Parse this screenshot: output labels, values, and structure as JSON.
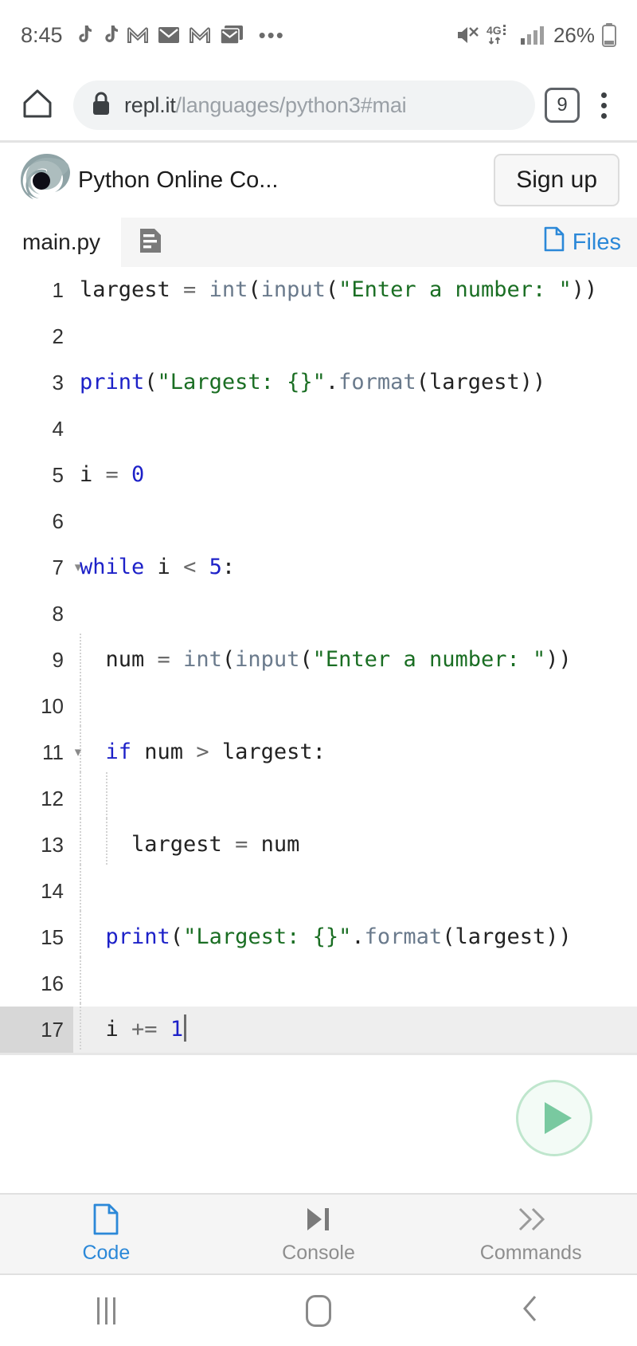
{
  "status_bar": {
    "time": "8:45",
    "notification_icons": [
      "tiktok-icon",
      "tiktok-icon",
      "gmail-icon",
      "mail-filled-icon",
      "gmail-icon",
      "mail-stack-icon"
    ],
    "overflow": "•••",
    "mute_icon": "volume-muted-icon",
    "network_label": "4G",
    "signal_icon": "signal-bars-icon",
    "battery_percent": "26%"
  },
  "browser": {
    "home_icon": "home-icon",
    "lock_icon": "lock-icon",
    "url_host": "repl.it",
    "url_path": "/languages/python3#mai",
    "url_full": "repl.it/languages/python3#mai",
    "tab_count": "9",
    "menu_icon": "kebab-menu-icon"
  },
  "app_header": {
    "logo_icon": "replit-swirl-logo",
    "title": "Python Online Co...",
    "signup_label": "Sign up"
  },
  "editor_tabs": {
    "filename": "main.py",
    "panel_icon": "file-lines-icon",
    "files_label": "Files",
    "files_icon": "file-icon"
  },
  "code": {
    "lines": [
      {
        "n": "1",
        "fold": "",
        "indent": 0,
        "tokens": [
          {
            "t": "largest ",
            "c": "plain"
          },
          {
            "t": "= ",
            "c": "op"
          },
          {
            "t": "int",
            "c": "fn"
          },
          {
            "t": "(",
            "c": "plain"
          },
          {
            "t": "input",
            "c": "fn"
          },
          {
            "t": "(",
            "c": "plain"
          },
          {
            "t": "\"Enter a number: \"",
            "c": "str"
          },
          {
            "t": "))",
            "c": "plain"
          }
        ]
      },
      {
        "n": "2",
        "fold": "",
        "indent": 0,
        "tokens": []
      },
      {
        "n": "3",
        "fold": "",
        "indent": 0,
        "tokens": [
          {
            "t": "print",
            "c": "kw"
          },
          {
            "t": "(",
            "c": "plain"
          },
          {
            "t": "\"Largest: {}\"",
            "c": "str"
          },
          {
            "t": ".",
            "c": "plain"
          },
          {
            "t": "format",
            "c": "fn"
          },
          {
            "t": "(largest))",
            "c": "plain"
          }
        ]
      },
      {
        "n": "4",
        "fold": "",
        "indent": 0,
        "tokens": []
      },
      {
        "n": "5",
        "fold": "",
        "indent": 0,
        "tokens": [
          {
            "t": "i ",
            "c": "plain"
          },
          {
            "t": "= ",
            "c": "op"
          },
          {
            "t": "0",
            "c": "num"
          }
        ]
      },
      {
        "n": "6",
        "fold": "",
        "indent": 0,
        "tokens": []
      },
      {
        "n": "7",
        "fold": "▾",
        "indent": 0,
        "tokens": [
          {
            "t": "while",
            "c": "kw"
          },
          {
            "t": " i ",
            "c": "plain"
          },
          {
            "t": "< ",
            "c": "op"
          },
          {
            "t": "5",
            "c": "num"
          },
          {
            "t": ":",
            "c": "plain"
          }
        ]
      },
      {
        "n": "8",
        "fold": "",
        "indent": 0,
        "tokens": []
      },
      {
        "n": "9",
        "fold": "",
        "indent": 1,
        "tokens": [
          {
            "t": "  num ",
            "c": "plain"
          },
          {
            "t": "= ",
            "c": "op"
          },
          {
            "t": "int",
            "c": "fn"
          },
          {
            "t": "(",
            "c": "plain"
          },
          {
            "t": "input",
            "c": "fn"
          },
          {
            "t": "(",
            "c": "plain"
          },
          {
            "t": "\"Enter a number: \"",
            "c": "str"
          },
          {
            "t": "))",
            "c": "plain"
          }
        ]
      },
      {
        "n": "10",
        "fold": "",
        "indent": 1,
        "tokens": []
      },
      {
        "n": "11",
        "fold": "▾",
        "indent": 1,
        "tokens": [
          {
            "t": "  ",
            "c": "plain"
          },
          {
            "t": "if",
            "c": "kw"
          },
          {
            "t": " num ",
            "c": "plain"
          },
          {
            "t": "> ",
            "c": "op"
          },
          {
            "t": "largest:",
            "c": "plain"
          }
        ]
      },
      {
        "n": "12",
        "fold": "",
        "indent": 2,
        "tokens": []
      },
      {
        "n": "13",
        "fold": "",
        "indent": 2,
        "tokens": [
          {
            "t": "    largest ",
            "c": "plain"
          },
          {
            "t": "= ",
            "c": "op"
          },
          {
            "t": "num",
            "c": "plain"
          }
        ]
      },
      {
        "n": "14",
        "fold": "",
        "indent": 1,
        "tokens": []
      },
      {
        "n": "15",
        "fold": "",
        "indent": 1,
        "tokens": [
          {
            "t": "  ",
            "c": "plain"
          },
          {
            "t": "print",
            "c": "kw"
          },
          {
            "t": "(",
            "c": "plain"
          },
          {
            "t": "\"Largest: {}\"",
            "c": "str"
          },
          {
            "t": ".",
            "c": "plain"
          },
          {
            "t": "format",
            "c": "fn"
          },
          {
            "t": "(largest))",
            "c": "plain"
          }
        ]
      },
      {
        "n": "16",
        "fold": "",
        "indent": 1,
        "tokens": []
      },
      {
        "n": "17",
        "fold": "",
        "indent": 1,
        "active": true,
        "caret": true,
        "tokens": [
          {
            "t": "  i ",
            "c": "plain"
          },
          {
            "t": "+= ",
            "c": "op"
          },
          {
            "t": "1",
            "c": "num"
          }
        ]
      }
    ],
    "source_text": "largest = int(input(\"Enter a number: \"))\n\nprint(\"Largest: {}\".format(largest))\n\ni = 0\n\nwhile i < 5:\n\n  num = int(input(\"Enter a number: \"))\n\n  if num > largest:\n\n    largest = num\n\n  print(\"Largest: {}\".format(largest))\n\n  i += 1",
    "active_line": "17"
  },
  "run_button": {
    "icon": "play-icon",
    "accent": "#79c9a0",
    "fill": "#f3fbf6"
  },
  "bottom_tabs": [
    {
      "label": "Code",
      "icon": "file-icon",
      "active": true
    },
    {
      "label": "Console",
      "icon": "step-play-icon",
      "active": false
    },
    {
      "label": "Commands",
      "icon": "chevrons-right-icon",
      "active": false
    }
  ],
  "nav_bar": {
    "recents_icon": "recents-icon",
    "home_icon": "home-square-icon",
    "back_icon": "back-chevron-icon"
  }
}
